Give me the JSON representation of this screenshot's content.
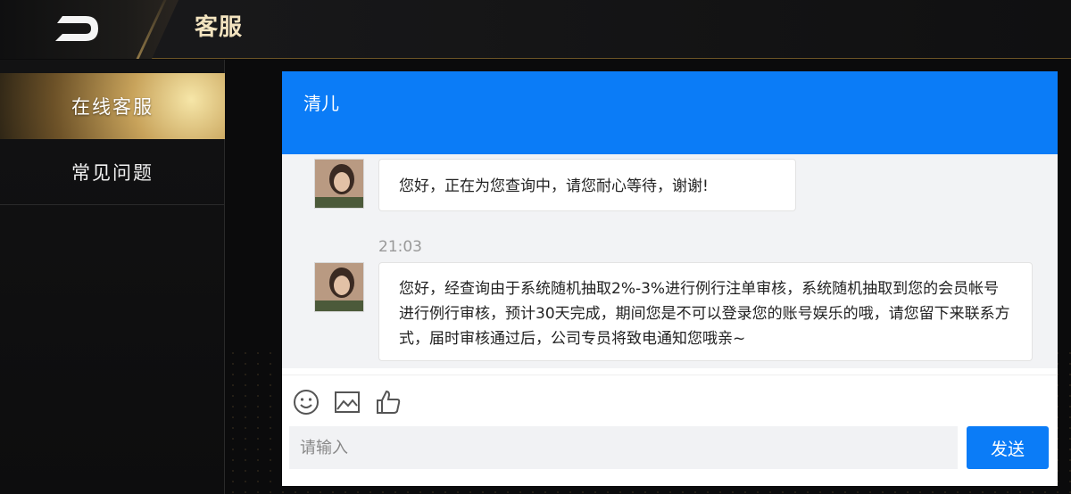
{
  "header": {
    "title": "客服",
    "back_icon": "back-arrow-icon"
  },
  "sidebar": {
    "items": [
      {
        "label": "在线客服",
        "active": true
      },
      {
        "label": "常见问题",
        "active": false
      }
    ]
  },
  "chat": {
    "agent_name": "清儿",
    "messages": [
      {
        "sender": "agent",
        "text": "您好，正在为您查询中，请您耐心等待，谢谢!"
      },
      {
        "timestamp": "21:03"
      },
      {
        "sender": "agent",
        "text": "您好，经查询由于系统随机抽取2%-3%进行例行注单审核，系统随机抽取到您的会员帐号进行例行审核，预计30天完成，期间您是不可以登录您的账号娱乐的哦，请您留下来联系方式，届时审核通过后，公司专员将致电通知您哦亲~"
      }
    ],
    "toolbar": [
      "emoji-icon",
      "image-icon",
      "thumbs-up-icon"
    ],
    "input_placeholder": "请输入",
    "send_label": "发送"
  },
  "colors": {
    "accent": "#0b7cf7",
    "gold": "#c8a35b"
  }
}
